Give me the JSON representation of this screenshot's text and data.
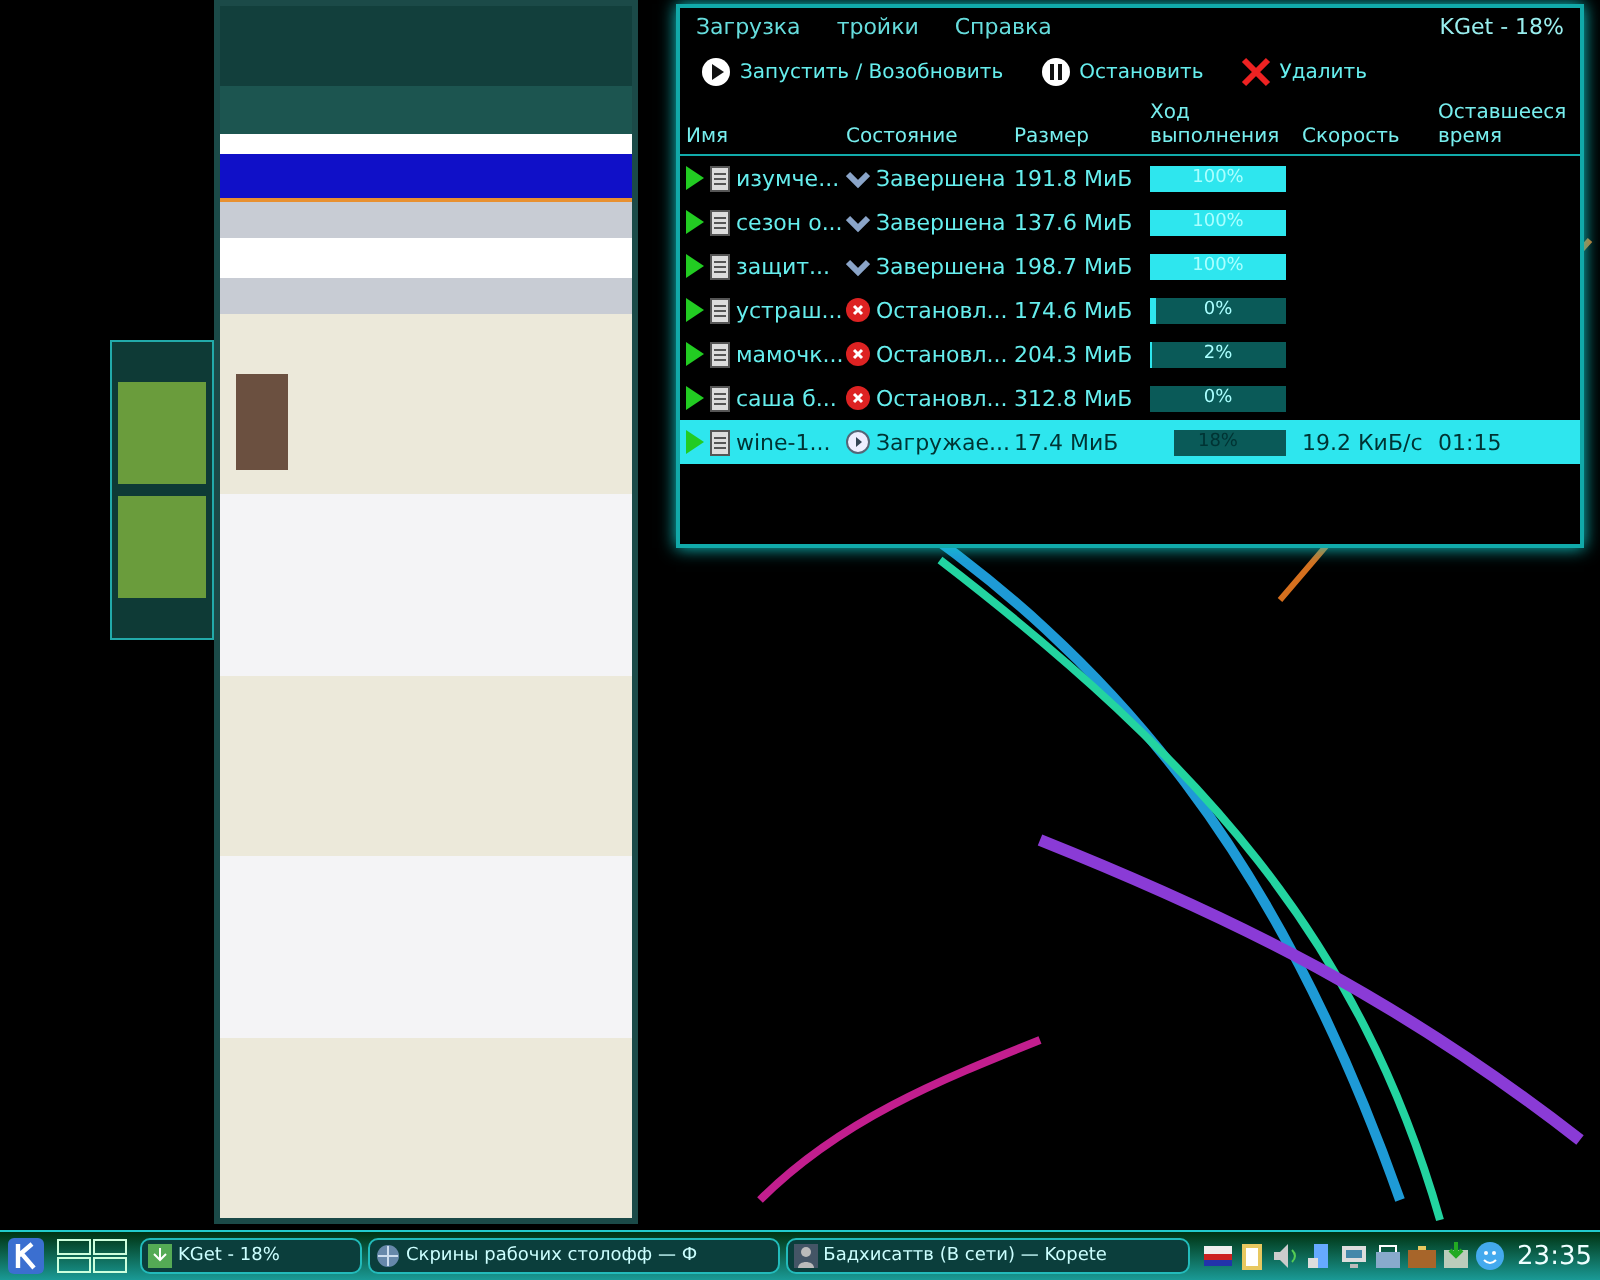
{
  "kget": {
    "menu": [
      "Загрузка",
      "тройки",
      "Справка"
    ],
    "title": "KGet - 18%",
    "toolbar": [
      {
        "label": "Запустить / Возобновить",
        "kind": "start"
      },
      {
        "label": "Остановить",
        "kind": "stop"
      },
      {
        "label": "Удалить",
        "kind": "delete"
      }
    ],
    "columns": [
      "Имя",
      "Состояние",
      "Размер",
      "Ход выполнения",
      "Скорость",
      "Оставшееся время"
    ],
    "rows": [
      {
        "name": "изумче...",
        "status": "Завершена",
        "kind": "done",
        "size": "191.8 МиБ",
        "level": 1,
        "progress": "100%",
        "selected": false
      },
      {
        "name": "сезон о...",
        "status": "Завершена",
        "kind": "done",
        "size": "137.6 МиБ",
        "level": 1,
        "progress": "100%",
        "selected": false
      },
      {
        "name": "защит...",
        "status": "Завершена",
        "kind": "done",
        "size": "198.7 МиБ",
        "level": 1,
        "progress": "100%",
        "selected": false
      },
      {
        "name": "устраш...",
        "status": "Остановл...",
        "kind": "stopped",
        "size": "174.6 МиБ",
        "level": 0.05,
        "progress": "0%",
        "selected": false
      },
      {
        "name": "мамочк...",
        "status": "Остановл...",
        "kind": "stopped",
        "size": "204.3 МиБ",
        "level": 0.02,
        "progress": "2%",
        "selected": false
      },
      {
        "name": "саша б...",
        "status": "Остановл...",
        "kind": "stopped",
        "size": "312.8 МиБ",
        "level": 0,
        "progress": "0%",
        "selected": false
      },
      {
        "name": "wine-1...",
        "status": "Загружае...",
        "kind": "loading",
        "size": "17.4 МиБ",
        "level": 0.18,
        "progress": "18%",
        "speed": "19.2 КиБ/с",
        "remaining": "01:15",
        "selected": true
      }
    ]
  },
  "taskbar": {
    "tasks": [
      {
        "label": "KGet - 18%",
        "kind": "kget"
      },
      {
        "label": "Скрины рабочих столофф — Ф",
        "kind": "browser"
      },
      {
        "label": "Бадхисаттв (В сети) — Kopete",
        "kind": "chat"
      }
    ],
    "clock": "23:35"
  }
}
